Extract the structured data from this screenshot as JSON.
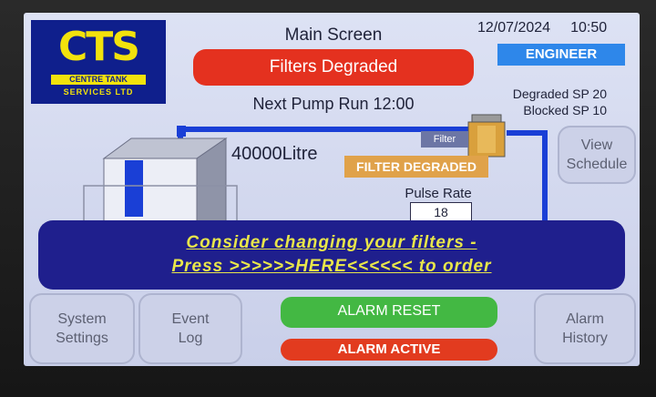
{
  "screen": {
    "title": "Main Screen",
    "status_message": "Filters Degraded",
    "date": "12/07/2024",
    "time": "10:50",
    "user_level": "ENGINEER",
    "next_pump_run": "Next Pump Run 12:00",
    "degraded_sp": "Degraded SP 20",
    "blocked_sp": "Blocked SP 10"
  },
  "logo": {
    "main": "CTS",
    "line1": "CENTRE TANK",
    "line2": "SERVICES LTD"
  },
  "tank": {
    "volume": "40000Litre",
    "filter_label": "Filter",
    "filter_status": "FILTER DEGRADED",
    "pulse_rate_label": "Pulse Rate",
    "pulse_rate_value": "18"
  },
  "banner": {
    "line1": "Consider changing your filters -",
    "line2": "Press >>>>>>HERE<<<<<< to order"
  },
  "buttons": {
    "view_schedule_line1": "View",
    "view_schedule_line2": "Schedule",
    "system_settings_line1": "System",
    "system_settings_line2": "Settings",
    "event_log_line1": "Event",
    "event_log_line2": "Log",
    "alarm_reset": "ALARM RESET",
    "alarm_active": "ALARM ACTIVE",
    "alarm_history_line1": "Alarm",
    "alarm_history_line2": "History"
  },
  "colors": {
    "status_red": "#e4311f",
    "engineer_blue": "#2e87ea",
    "banner_navy": "#1f1f8d",
    "banner_text": "#e8e64a",
    "reset_green": "#43b843",
    "filter_orange": "#e0a24a"
  }
}
